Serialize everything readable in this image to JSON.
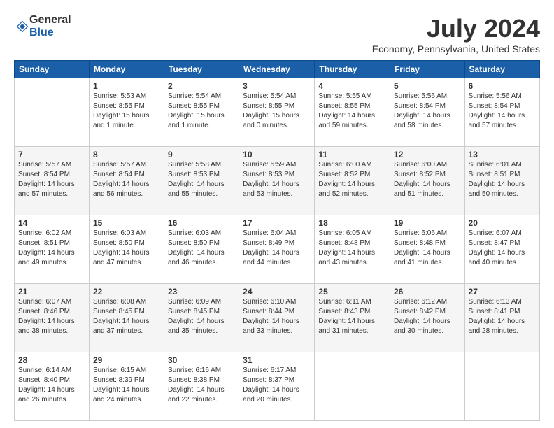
{
  "header": {
    "logo_general": "General",
    "logo_blue": "Blue",
    "month_year": "July 2024",
    "location": "Economy, Pennsylvania, United States"
  },
  "days_of_week": [
    "Sunday",
    "Monday",
    "Tuesday",
    "Wednesday",
    "Thursday",
    "Friday",
    "Saturday"
  ],
  "weeks": [
    [
      {
        "day": "",
        "sunrise": "",
        "sunset": "",
        "daylight": ""
      },
      {
        "day": "1",
        "sunrise": "Sunrise: 5:53 AM",
        "sunset": "Sunset: 8:55 PM",
        "daylight": "Daylight: 15 hours and 1 minute."
      },
      {
        "day": "2",
        "sunrise": "Sunrise: 5:54 AM",
        "sunset": "Sunset: 8:55 PM",
        "daylight": "Daylight: 15 hours and 1 minute."
      },
      {
        "day": "3",
        "sunrise": "Sunrise: 5:54 AM",
        "sunset": "Sunset: 8:55 PM",
        "daylight": "Daylight: 15 hours and 0 minutes."
      },
      {
        "day": "4",
        "sunrise": "Sunrise: 5:55 AM",
        "sunset": "Sunset: 8:55 PM",
        "daylight": "Daylight: 14 hours and 59 minutes."
      },
      {
        "day": "5",
        "sunrise": "Sunrise: 5:56 AM",
        "sunset": "Sunset: 8:54 PM",
        "daylight": "Daylight: 14 hours and 58 minutes."
      },
      {
        "day": "6",
        "sunrise": "Sunrise: 5:56 AM",
        "sunset": "Sunset: 8:54 PM",
        "daylight": "Daylight: 14 hours and 57 minutes."
      }
    ],
    [
      {
        "day": "7",
        "sunrise": "Sunrise: 5:57 AM",
        "sunset": "Sunset: 8:54 PM",
        "daylight": "Daylight: 14 hours and 57 minutes."
      },
      {
        "day": "8",
        "sunrise": "Sunrise: 5:57 AM",
        "sunset": "Sunset: 8:54 PM",
        "daylight": "Daylight: 14 hours and 56 minutes."
      },
      {
        "day": "9",
        "sunrise": "Sunrise: 5:58 AM",
        "sunset": "Sunset: 8:53 PM",
        "daylight": "Daylight: 14 hours and 55 minutes."
      },
      {
        "day": "10",
        "sunrise": "Sunrise: 5:59 AM",
        "sunset": "Sunset: 8:53 PM",
        "daylight": "Daylight: 14 hours and 53 minutes."
      },
      {
        "day": "11",
        "sunrise": "Sunrise: 6:00 AM",
        "sunset": "Sunset: 8:52 PM",
        "daylight": "Daylight: 14 hours and 52 minutes."
      },
      {
        "day": "12",
        "sunrise": "Sunrise: 6:00 AM",
        "sunset": "Sunset: 8:52 PM",
        "daylight": "Daylight: 14 hours and 51 minutes."
      },
      {
        "day": "13",
        "sunrise": "Sunrise: 6:01 AM",
        "sunset": "Sunset: 8:51 PM",
        "daylight": "Daylight: 14 hours and 50 minutes."
      }
    ],
    [
      {
        "day": "14",
        "sunrise": "Sunrise: 6:02 AM",
        "sunset": "Sunset: 8:51 PM",
        "daylight": "Daylight: 14 hours and 49 minutes."
      },
      {
        "day": "15",
        "sunrise": "Sunrise: 6:03 AM",
        "sunset": "Sunset: 8:50 PM",
        "daylight": "Daylight: 14 hours and 47 minutes."
      },
      {
        "day": "16",
        "sunrise": "Sunrise: 6:03 AM",
        "sunset": "Sunset: 8:50 PM",
        "daylight": "Daylight: 14 hours and 46 minutes."
      },
      {
        "day": "17",
        "sunrise": "Sunrise: 6:04 AM",
        "sunset": "Sunset: 8:49 PM",
        "daylight": "Daylight: 14 hours and 44 minutes."
      },
      {
        "day": "18",
        "sunrise": "Sunrise: 6:05 AM",
        "sunset": "Sunset: 8:48 PM",
        "daylight": "Daylight: 14 hours and 43 minutes."
      },
      {
        "day": "19",
        "sunrise": "Sunrise: 6:06 AM",
        "sunset": "Sunset: 8:48 PM",
        "daylight": "Daylight: 14 hours and 41 minutes."
      },
      {
        "day": "20",
        "sunrise": "Sunrise: 6:07 AM",
        "sunset": "Sunset: 8:47 PM",
        "daylight": "Daylight: 14 hours and 40 minutes."
      }
    ],
    [
      {
        "day": "21",
        "sunrise": "Sunrise: 6:07 AM",
        "sunset": "Sunset: 8:46 PM",
        "daylight": "Daylight: 14 hours and 38 minutes."
      },
      {
        "day": "22",
        "sunrise": "Sunrise: 6:08 AM",
        "sunset": "Sunset: 8:45 PM",
        "daylight": "Daylight: 14 hours and 37 minutes."
      },
      {
        "day": "23",
        "sunrise": "Sunrise: 6:09 AM",
        "sunset": "Sunset: 8:45 PM",
        "daylight": "Daylight: 14 hours and 35 minutes."
      },
      {
        "day": "24",
        "sunrise": "Sunrise: 6:10 AM",
        "sunset": "Sunset: 8:44 PM",
        "daylight": "Daylight: 14 hours and 33 minutes."
      },
      {
        "day": "25",
        "sunrise": "Sunrise: 6:11 AM",
        "sunset": "Sunset: 8:43 PM",
        "daylight": "Daylight: 14 hours and 31 minutes."
      },
      {
        "day": "26",
        "sunrise": "Sunrise: 6:12 AM",
        "sunset": "Sunset: 8:42 PM",
        "daylight": "Daylight: 14 hours and 30 minutes."
      },
      {
        "day": "27",
        "sunrise": "Sunrise: 6:13 AM",
        "sunset": "Sunset: 8:41 PM",
        "daylight": "Daylight: 14 hours and 28 minutes."
      }
    ],
    [
      {
        "day": "28",
        "sunrise": "Sunrise: 6:14 AM",
        "sunset": "Sunset: 8:40 PM",
        "daylight": "Daylight: 14 hours and 26 minutes."
      },
      {
        "day": "29",
        "sunrise": "Sunrise: 6:15 AM",
        "sunset": "Sunset: 8:39 PM",
        "daylight": "Daylight: 14 hours and 24 minutes."
      },
      {
        "day": "30",
        "sunrise": "Sunrise: 6:16 AM",
        "sunset": "Sunset: 8:38 PM",
        "daylight": "Daylight: 14 hours and 22 minutes."
      },
      {
        "day": "31",
        "sunrise": "Sunrise: 6:17 AM",
        "sunset": "Sunset: 8:37 PM",
        "daylight": "Daylight: 14 hours and 20 minutes."
      },
      {
        "day": "",
        "sunrise": "",
        "sunset": "",
        "daylight": ""
      },
      {
        "day": "",
        "sunrise": "",
        "sunset": "",
        "daylight": ""
      },
      {
        "day": "",
        "sunrise": "",
        "sunset": "",
        "daylight": ""
      }
    ]
  ]
}
